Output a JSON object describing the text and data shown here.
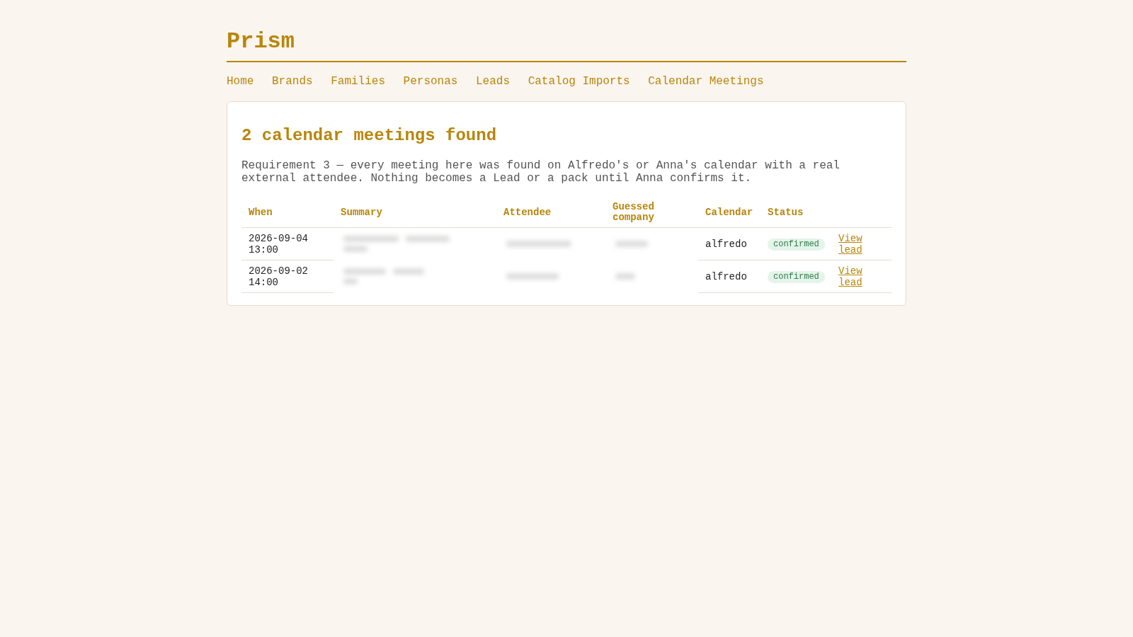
{
  "app": {
    "title": "Prism"
  },
  "nav": [
    {
      "label": "Home"
    },
    {
      "label": "Brands"
    },
    {
      "label": "Families"
    },
    {
      "label": "Personas"
    },
    {
      "label": "Leads"
    },
    {
      "label": "Catalog Imports"
    },
    {
      "label": "Calendar Meetings"
    }
  ],
  "card": {
    "heading": "2 calendar meetings found",
    "description": "Requirement 3 — every meeting here was found on Alfredo's or Anna's calendar with a real external attendee. Nothing becomes a Lead or a pack until Anna confirms it.",
    "table": {
      "columns": [
        "When",
        "Summary",
        "Attendee",
        "Guessed company",
        "Calendar",
        "Status"
      ],
      "rows": [
        {
          "cells": [
            {
              "kind": "text",
              "text": "2026-09-04 13:00"
            },
            {
              "kind": "redacted"
            },
            {
              "kind": "redacted"
            },
            {
              "kind": "redacted"
            },
            {
              "kind": "text",
              "text": "alfredo"
            },
            {
              "kind": "badge",
              "text": "confirmed"
            },
            {
              "kind": "link",
              "text": "View lead"
            }
          ]
        },
        {
          "cells": [
            {
              "kind": "text",
              "text": "2026-09-02 14:00"
            },
            {
              "kind": "redacted"
            },
            {
              "kind": "redacted"
            },
            {
              "kind": "redacted"
            },
            {
              "kind": "text",
              "text": "alfredo"
            },
            {
              "kind": "badge",
              "text": "confirmed"
            },
            {
              "kind": "link",
              "text": "View lead"
            }
          ]
        }
      ]
    }
  }
}
